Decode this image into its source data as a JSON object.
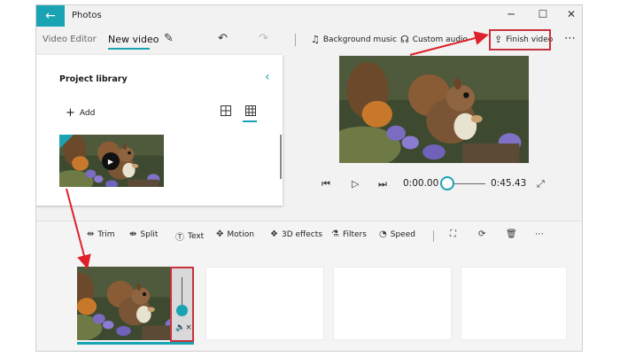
{
  "app": {
    "title": "Photos"
  },
  "window_controls": {
    "minimize": "─",
    "maximize": "☐",
    "close": "✕"
  },
  "breadcrumb": {
    "parent": "Video Editor",
    "current": "New video"
  },
  "toolbar": {
    "background_music_label": "Background music",
    "custom_audio_label": "Custom audio",
    "finish_video_label": "Finish video",
    "more": "⋯"
  },
  "library": {
    "title": "Project library",
    "add_label": "Add"
  },
  "player": {
    "current_time": "0:00.00",
    "total_time": "0:45.43"
  },
  "edit_tools": [
    {
      "label": "Trim"
    },
    {
      "label": "Split"
    },
    {
      "label": "Text"
    },
    {
      "label": "Motion"
    },
    {
      "label": "3D effects"
    },
    {
      "label": "Filters"
    },
    {
      "label": "Speed"
    }
  ],
  "colors": {
    "accent": "#1aa3b3",
    "highlight": "#c8323c"
  }
}
